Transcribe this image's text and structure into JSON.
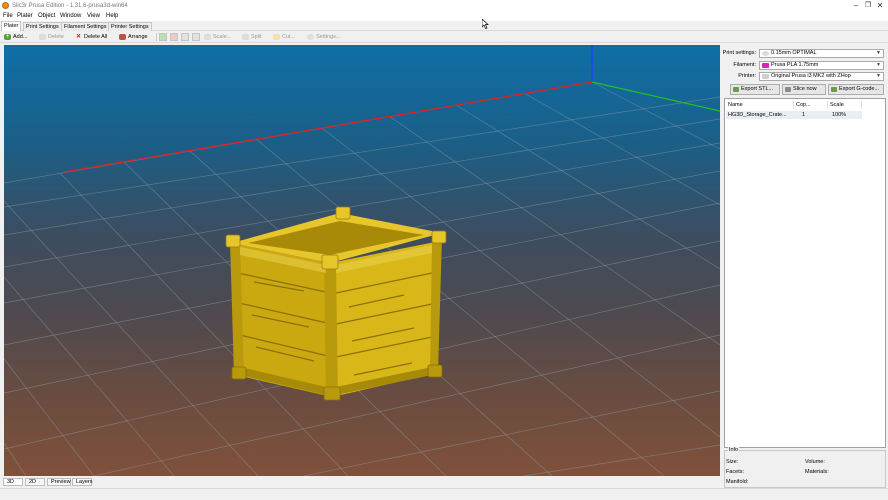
{
  "window": {
    "title": "Slic3r Prusa Edition - 1.31.6-prusa3d-win64",
    "minimize": "–",
    "maximize": "❐",
    "close": "✕"
  },
  "menu": [
    "File",
    "Plater",
    "Object",
    "Window",
    "View",
    "Help"
  ],
  "tabs": [
    "Plater",
    "Print Settings",
    "Filament Settings",
    "Printer Settings"
  ],
  "toolbar": {
    "add": "Add...",
    "delete": "Delete",
    "delete_all": "Delete All",
    "arrange": "Arrange",
    "scale": "Scale...",
    "split": "Split",
    "cut": "Cut...",
    "settings": "Settings..."
  },
  "settings": {
    "print_label": "Print settings:",
    "print_value": "0.15mm OPTIMAL",
    "filament_label": "Filament:",
    "filament_value": "Prusa PLA 1.75mm",
    "filament_color": "#e020c0",
    "printer_label": "Printer:",
    "printer_value": "Original Prusa i3 MK2 with ZHop"
  },
  "actions": {
    "export_stl": "Export STL...",
    "slice_now": "Slice now",
    "export_gcode": "Export G-code..."
  },
  "object_list": {
    "columns": [
      "Name",
      "Cop...",
      "Scale"
    ],
    "rows": [
      {
        "name": "HG3D_Storage_Crate...",
        "copies": "1",
        "scale": "100%"
      }
    ]
  },
  "info": {
    "title": "Info",
    "size": "Size:",
    "volume": "Volume:",
    "facets": "Facets:",
    "materials": "Materials:",
    "manifold": "Manifold:"
  },
  "view_tabs": [
    "3D",
    "2D",
    "Preview",
    "Layers"
  ],
  "colors": {
    "model": "#c9a810",
    "x_axis": "#e02020",
    "y_axis": "#20c020",
    "z_axis": "#2040ff"
  }
}
